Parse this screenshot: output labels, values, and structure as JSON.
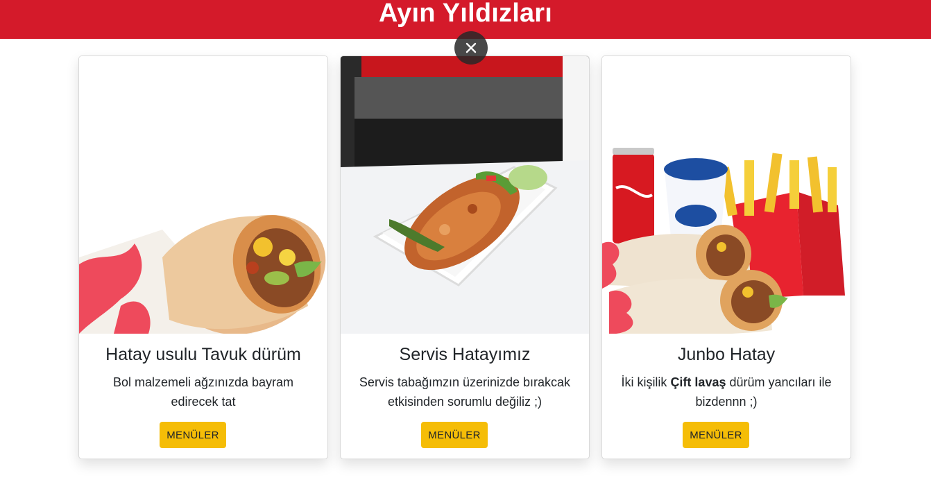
{
  "header": {
    "title": "Ayın Yıldızları"
  },
  "close_label": "×",
  "colors": {
    "banner": "#d41a2a",
    "button": "#f5bd07"
  },
  "cards": [
    {
      "title": "Hatay usulu Tavuk dürüm",
      "desc_plain": "Bol malzemeli ağzınızda bayram edirecek tat",
      "desc_pre": "",
      "desc_bold": "",
      "desc_post": "",
      "button": "MENÜLER",
      "image_icon": "chicken-wrap-image"
    },
    {
      "title": "Servis Hatayımız",
      "desc_plain": "Servis tabağımzın üzerinizde bırakcak etkisinden sorumlu değiliz ;)",
      "desc_pre": "",
      "desc_bold": "",
      "desc_post": "",
      "button": "MENÜLER",
      "image_icon": "doner-plate-image"
    },
    {
      "title": "Junbo Hatay",
      "desc_plain": "",
      "desc_pre": "İki kişilik ",
      "desc_bold": "Çift lavaş",
      "desc_post": " dürüm yancıları ile bizdennn ;)",
      "button": "MENÜLER",
      "image_icon": "combo-menu-image"
    }
  ]
}
